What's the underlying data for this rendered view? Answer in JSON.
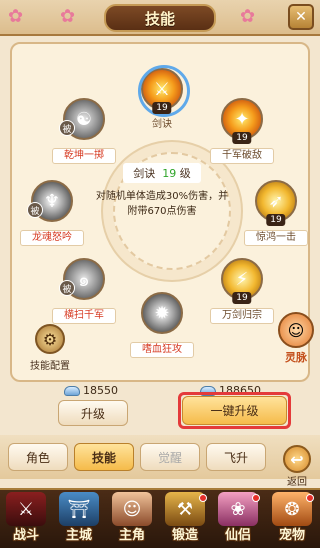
{
  "header": {
    "title": "技能",
    "close_icon": "close-icon"
  },
  "skills": {
    "jianjue": {
      "name": "剑诀",
      "level": "19"
    },
    "qiankun": {
      "name": "乾坤一掷",
      "passive_badge": "被"
    },
    "qianjun": {
      "name": "千军破敌",
      "level": "19"
    },
    "longhun": {
      "name": "龙魂怒吟",
      "passive_badge": "被"
    },
    "jinghong": {
      "name": "惊鸿一击",
      "level": "19"
    },
    "hengsao": {
      "name": "横扫千军",
      "passive_badge": "被"
    },
    "wanjian": {
      "name": "万剑归宗",
      "level": "19"
    },
    "shixue": {
      "name": "嗜血狂攻"
    }
  },
  "info": {
    "skill_name": "剑诀",
    "level_value": "19",
    "level_suffix": "级",
    "desc_line1": "对随机单体造成30%伤害，并",
    "desc_line2": "附带670点伤害"
  },
  "config": {
    "label": "技能配置"
  },
  "spirit": {
    "label": "灵脉"
  },
  "costs": {
    "upgrade_cost": "18550",
    "onekey_cost": "188650"
  },
  "buttons": {
    "upgrade": "升级",
    "onekey_upgrade": "一键升级"
  },
  "tabs": [
    "角色",
    "技能",
    "觉醒",
    "飞升"
  ],
  "back": {
    "label": "返回"
  },
  "bottom_nav": [
    "战斗",
    "主城",
    "主角",
    "锻造",
    "仙侣",
    "宠物"
  ],
  "colors": {
    "highlight": "#e43a3a",
    "level_green": "#2fa52a",
    "skill_name_red": "#d63b23"
  }
}
